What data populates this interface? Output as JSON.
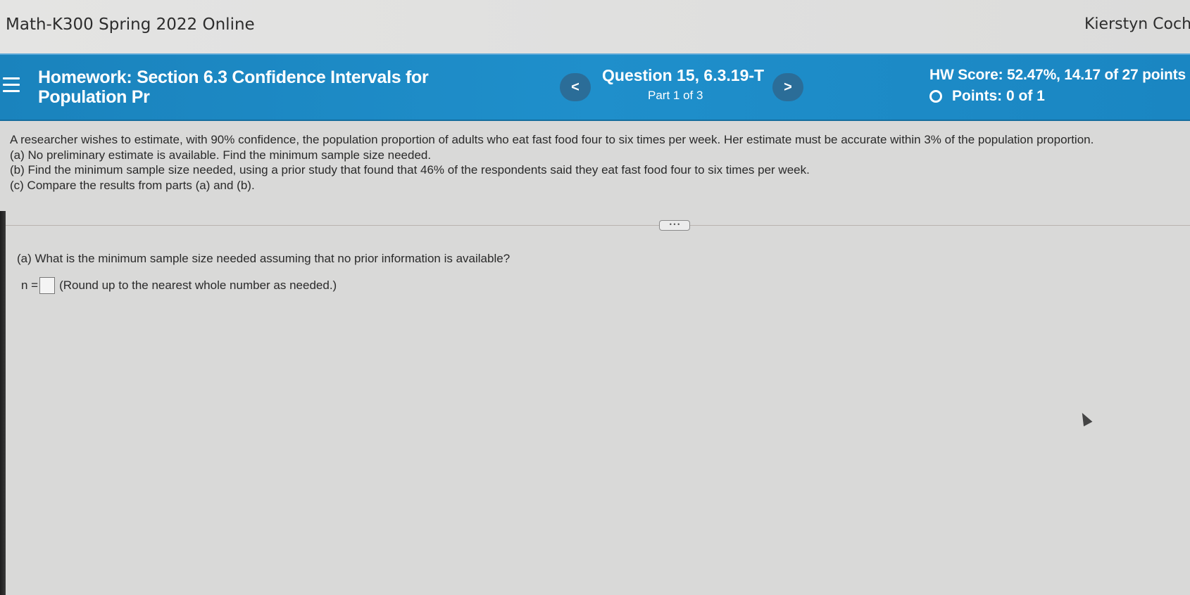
{
  "topbar": {
    "course_title": "Math-K300 Spring 2022 Online",
    "user_name": "Kierstyn Cochr"
  },
  "header": {
    "title_line1": "Homework: Section 6.3 Confidence Intervals for",
    "title_line2": "Population Pr",
    "prev_label": "<",
    "next_label": ">",
    "question_title": "Question 15, 6.3.19-T",
    "question_part": "Part 1 of 3",
    "hw_score": "HW Score: 52.47%, 14.17 of 27 points",
    "points": "Points: 0 of 1"
  },
  "problem": {
    "lines": [
      "A researcher wishes to estimate, with 90% confidence, the population proportion of adults who eat fast food four to six times per week. Her estimate must be accurate within 3% of the population proportion.",
      "(a) No preliminary estimate is available. Find the minimum sample size needed.",
      "(b) Find the minimum sample size needed, using a prior study that found that 46% of the  respondents said they eat fast food four to six times per week.",
      "(c) Compare the results from parts (a) and (b)."
    ]
  },
  "question": {
    "prompt": "(a) What is the minimum sample size needed assuming that no prior information is available?",
    "n_label": "n =",
    "input_value": "",
    "hint": "(Round up to the nearest whole number as needed.)"
  },
  "colors": {
    "header_blue": "#1f8fcb",
    "nav_button": "#2b6d98",
    "page_bg": "#d9d9d8"
  },
  "icons": {
    "menu": "hamburger-icon",
    "points_status": "empty-circle-icon",
    "mouse": "mouse-pointer-icon"
  }
}
